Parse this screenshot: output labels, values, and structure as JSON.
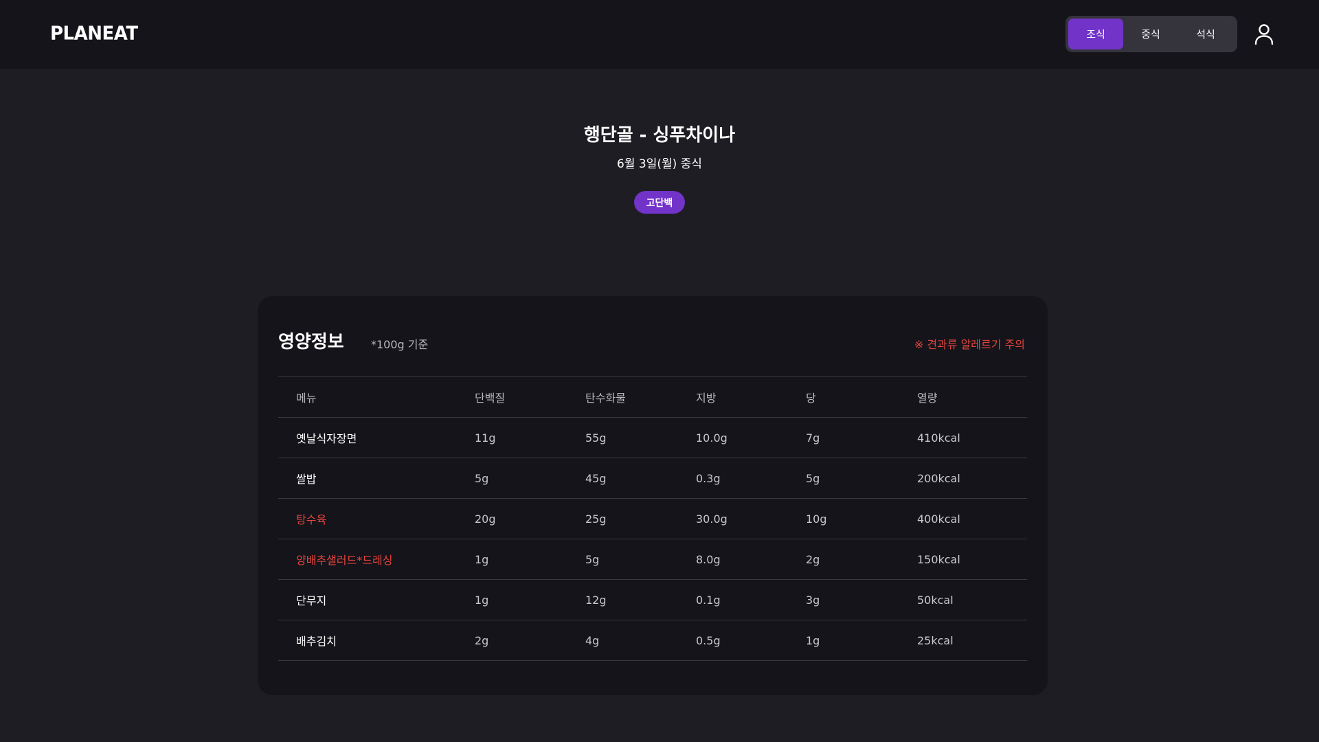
{
  "app": {
    "logo": "PLANEAT"
  },
  "header": {
    "meals": [
      {
        "label": "조식",
        "active": true
      },
      {
        "label": "중식",
        "active": false
      },
      {
        "label": "석식",
        "active": false
      }
    ],
    "profile_icon": "user-icon"
  },
  "restaurant": {
    "title": "행단골 - 싱푸차이나",
    "date": "6월 3일(월) 중식",
    "tag": "고단백"
  },
  "nutrition": {
    "title": "영양정보",
    "basis": "*100g 기준",
    "allergy_warning": "※ 견과류 알레르기 주의",
    "columns": [
      "메뉴",
      "단백질",
      "탄수화물",
      "지방",
      "당",
      "열량"
    ],
    "rows": [
      {
        "menu": "옛날식자장면",
        "protein": "11g",
        "carb": "55g",
        "fat": "10.0g",
        "sugar": "7g",
        "kcal": "410kcal",
        "allergen": false
      },
      {
        "menu": "쌀밥",
        "protein": "5g",
        "carb": "45g",
        "fat": "0.3g",
        "sugar": "5g",
        "kcal": "200kcal",
        "allergen": false
      },
      {
        "menu": "탕수육",
        "protein": "20g",
        "carb": "25g",
        "fat": "30.0g",
        "sugar": "10g",
        "kcal": "400kcal",
        "allergen": true
      },
      {
        "menu": "양배추샐러드*드레싱",
        "protein": "1g",
        "carb": "5g",
        "fat": "8.0g",
        "sugar": "2g",
        "kcal": "150kcal",
        "allergen": true
      },
      {
        "menu": "단무지",
        "protein": "1g",
        "carb": "12g",
        "fat": "0.1g",
        "sugar": "3g",
        "kcal": "50kcal",
        "allergen": false
      },
      {
        "menu": "배추김치",
        "protein": "2g",
        "carb": "4g",
        "fat": "0.5g",
        "sugar": "1g",
        "kcal": "25kcal",
        "allergen": false
      }
    ]
  },
  "colors": {
    "accent": "#7233c9",
    "warning": "#e5453e",
    "background": "#1e1d24",
    "surface": "#15141a"
  }
}
